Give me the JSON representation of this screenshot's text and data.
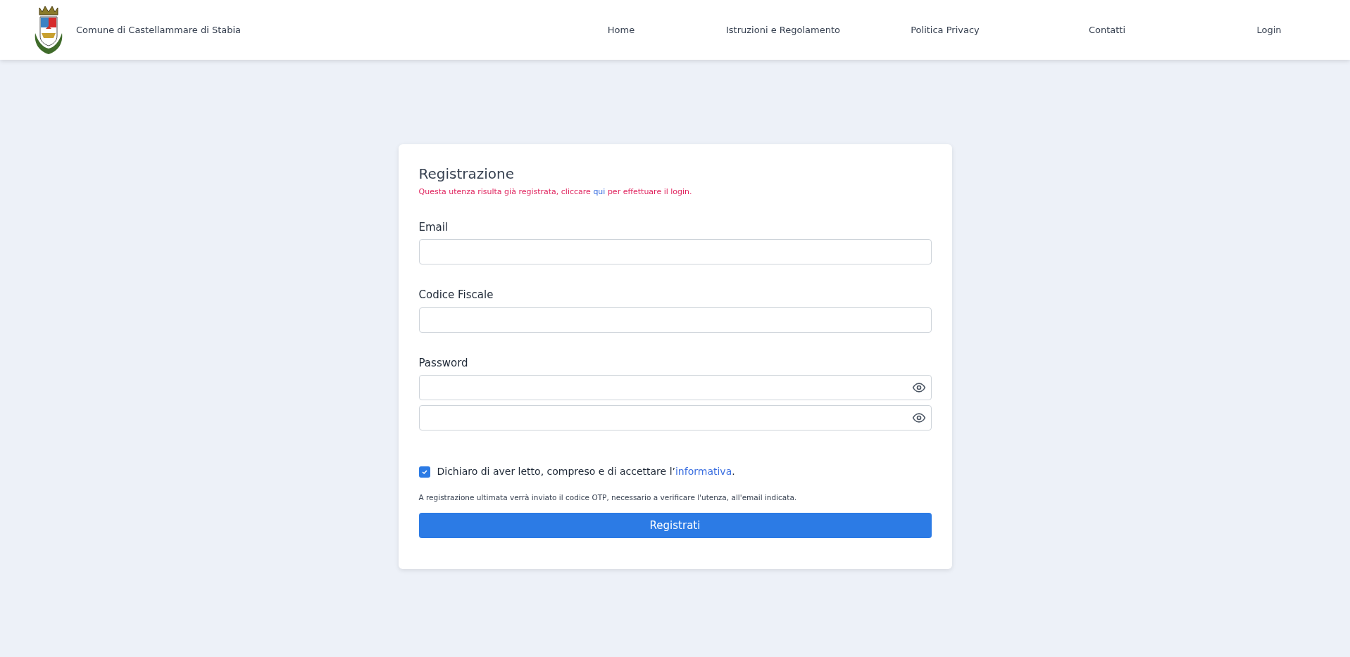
{
  "header": {
    "site_name": "Comune di Castellammare di Stabia",
    "nav": [
      {
        "label": "Home"
      },
      {
        "label": "Istruzioni e Regolamento"
      },
      {
        "label": "Politica Privacy"
      },
      {
        "label": "Contatti"
      },
      {
        "label": "Login"
      }
    ]
  },
  "form": {
    "title": "Registrazione",
    "notice": {
      "before": "Questa utenza risulta già registrata, cliccare ",
      "link": "qui",
      "after": " per effettuare il login."
    },
    "fields": [
      {
        "label": "Email",
        "kind": "text"
      },
      {
        "label": "Codice Fiscale",
        "kind": "text"
      },
      {
        "label": "Password",
        "kind": "password_with_confirm"
      }
    ],
    "consent": {
      "checked": true,
      "before": "Dichiaro di aver letto, compreso e di accettare l’",
      "link": "informativa",
      "after": "."
    },
    "note": "A registrazione ultimata verrà inviato il codice OTP, necessario a verificare l'utenza, all'email indicata.",
    "submit": "Registrati"
  }
}
